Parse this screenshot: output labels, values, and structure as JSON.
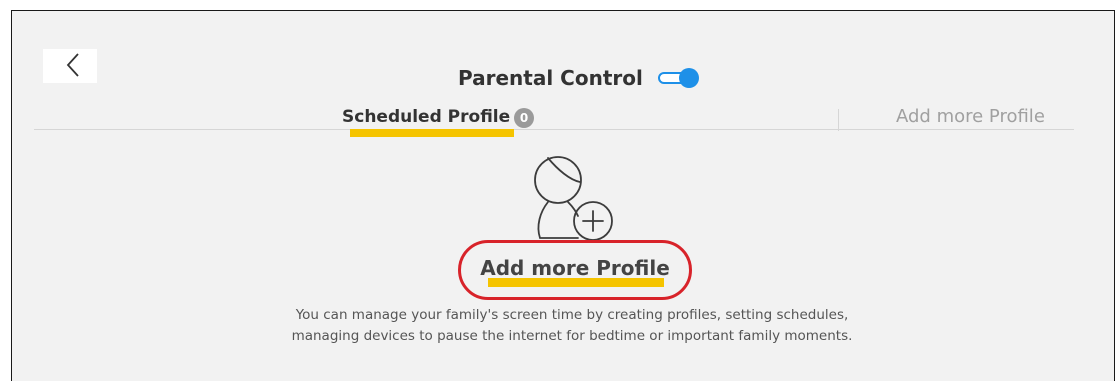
{
  "header": {
    "title": "Parental Control",
    "toggle_on": true,
    "accent_color": "#1e90e8"
  },
  "tabs": {
    "scheduled_label": "Scheduled Profile",
    "scheduled_count": "0",
    "add_label": "Add more Profile"
  },
  "main": {
    "add_profile_label": "Add more Profile",
    "description": "You can manage your family's screen time by creating profiles, setting schedules, managing devices to pause the internet for bedtime or important family moments.",
    "icon": "add-person-icon"
  },
  "annotations": {
    "highlight_color": "#f5c400",
    "circle_color": "#d8232a"
  }
}
